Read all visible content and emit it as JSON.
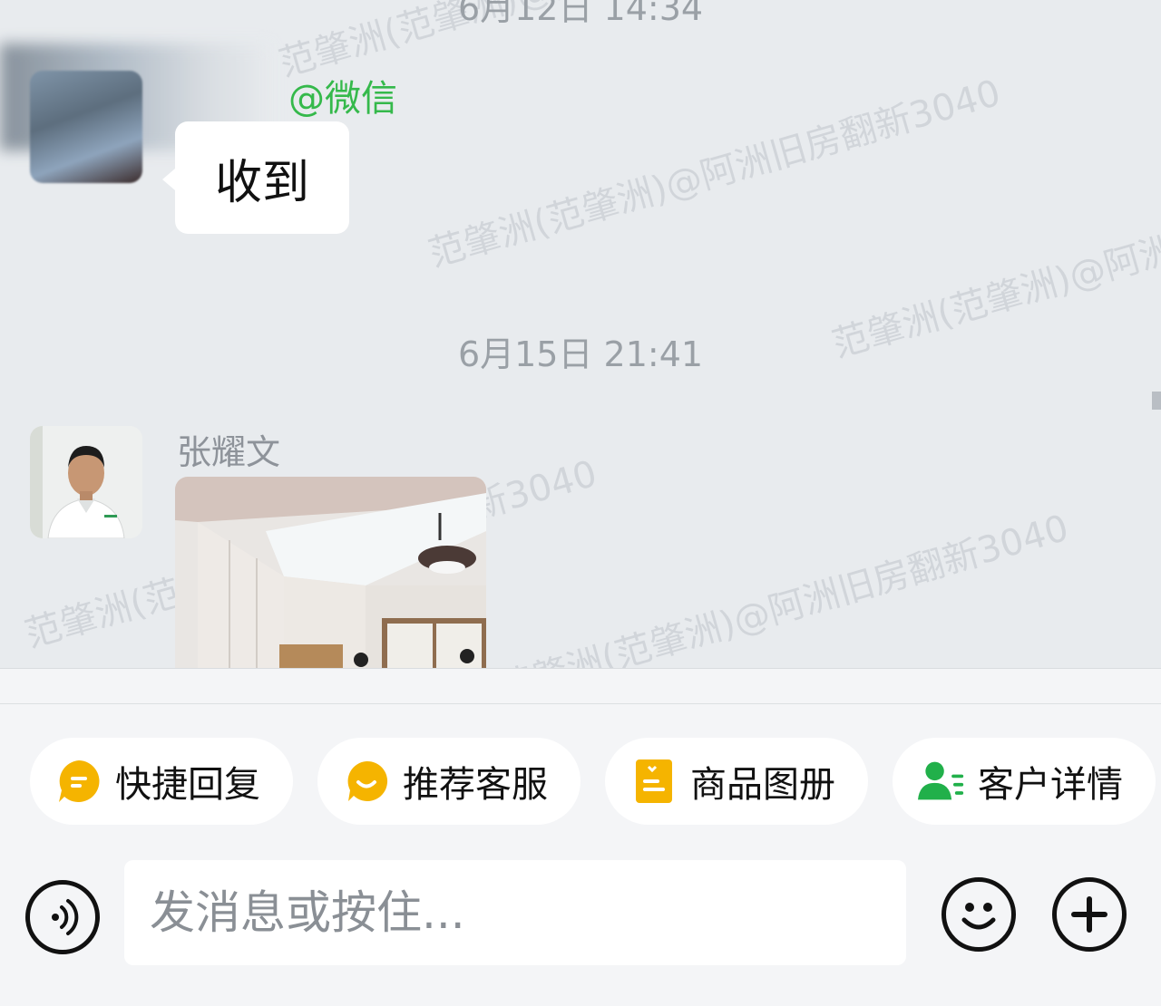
{
  "watermark_text": "范肇洲(范肇洲)@阿洲旧房翻新3040",
  "messages": {
    "prev_timestamp": "6月12日 14:34",
    "prev_sender_tag": "@微信",
    "prev_text": "收到",
    "timestamp": "6月15日  21:41",
    "sender_name": "张耀文"
  },
  "quick_actions": [
    {
      "label": "快捷回复",
      "icon": "quick-reply-icon",
      "color": "#f5b400"
    },
    {
      "label": "推荐客服",
      "icon": "recommend-service-icon",
      "color": "#f5b400"
    },
    {
      "label": "商品图册",
      "icon": "product-album-icon",
      "color": "#f5b400"
    },
    {
      "label": "客户详情",
      "icon": "customer-detail-icon",
      "color": "#21b04a"
    }
  ],
  "input": {
    "placeholder": "发消息或按住..."
  }
}
